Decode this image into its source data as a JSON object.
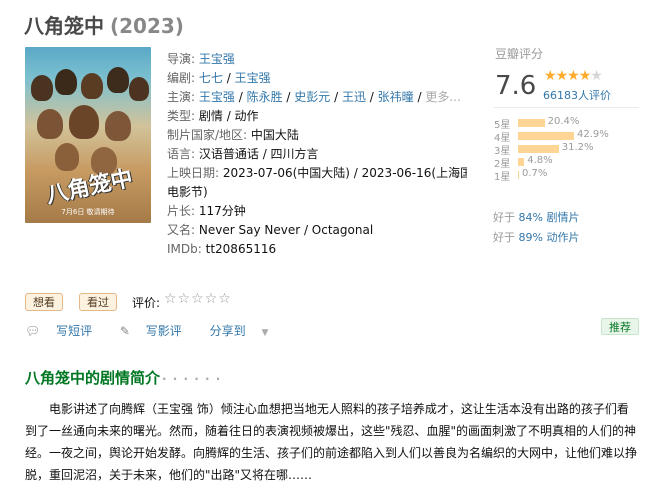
{
  "title": {
    "name": "八角笼中",
    "year": "(2023)"
  },
  "poster": {
    "title_text": "八角笼中",
    "date_text": "7月6日 敬请期待"
  },
  "info": {
    "director_label": "导演:",
    "director": "王宝强",
    "writer_label": "编剧:",
    "writers": [
      "七七",
      "王宝强"
    ],
    "cast_label": "主演:",
    "cast": [
      "王宝强",
      "陈永胜",
      "史彭元",
      "王迅",
      "张祎曈"
    ],
    "cast_more": "更多...",
    "genre_label": "类型:",
    "genre": "剧情 / 动作",
    "country_label": "制片国家/地区:",
    "country": "中国大陆",
    "language_label": "语言:",
    "language": "汉语普通话 / 四川方言",
    "release_label": "上映日期:",
    "release_1": "2023-07-06(中国大陆)",
    "release_2": "2023-06-16(上海国际",
    "release_3": "电影节)",
    "runtime_label": "片长:",
    "runtime": "117分钟",
    "aka_label": "又名:",
    "aka": "Never Say Never / Octagonal",
    "imdb_label": "IMDb:",
    "imdb": "tt20865116"
  },
  "rating": {
    "label": "豆瓣评分",
    "score": "7.6",
    "votes": "66183人评价",
    "star_level": 4,
    "distribution": [
      {
        "label": "5星",
        "pct": "20.4%",
        "value": 20.4
      },
      {
        "label": "4星",
        "pct": "42.9%",
        "value": 42.9
      },
      {
        "label": "3星",
        "pct": "31.2%",
        "value": 31.2
      },
      {
        "label": "2星",
        "pct": "4.8%",
        "value": 4.8
      },
      {
        "label": "1星",
        "pct": "0.7%",
        "value": 0.7
      }
    ],
    "better_than": [
      {
        "prefix": "好于",
        "pct": "84%",
        "genre": "剧情片"
      },
      {
        "prefix": "好于",
        "pct": "89%",
        "genre": "动作片"
      }
    ]
  },
  "interest": {
    "want_label": "想看",
    "seen_label": "看过",
    "rate_label": "评价:",
    "empty_stars": "☆☆☆☆☆"
  },
  "actions": {
    "comment_label": "写短评",
    "review_label": "写影评",
    "share_label": "分享到",
    "recommend_label": "推荐"
  },
  "synopsis": {
    "title": "八角笼中的剧情简介",
    "dots": "· · · · · ·",
    "text": "电影讲述了向腾辉（王宝强 饰）倾注心血想把当地无人照料的孩子培养成才，这让生活本没有出路的孩子们看到了一丝通向未来的曙光。然而，随着往日的表演视频被爆出，这些\"残忍、血腥\"的画面刺激了不明真相的人们的神经。一夜之间，舆论开始发酵。向腾辉的生活、孩子们的前途都陷入到人们以善良为名编织的大网中，让他们难以挣脱，重回泥沼，关于未来，他们的\"出路\"又将在哪……"
  },
  "colors": {
    "link": "#3377aa",
    "star": "#ffac2d",
    "bar": "#ffd596",
    "section_title": "#007722"
  }
}
